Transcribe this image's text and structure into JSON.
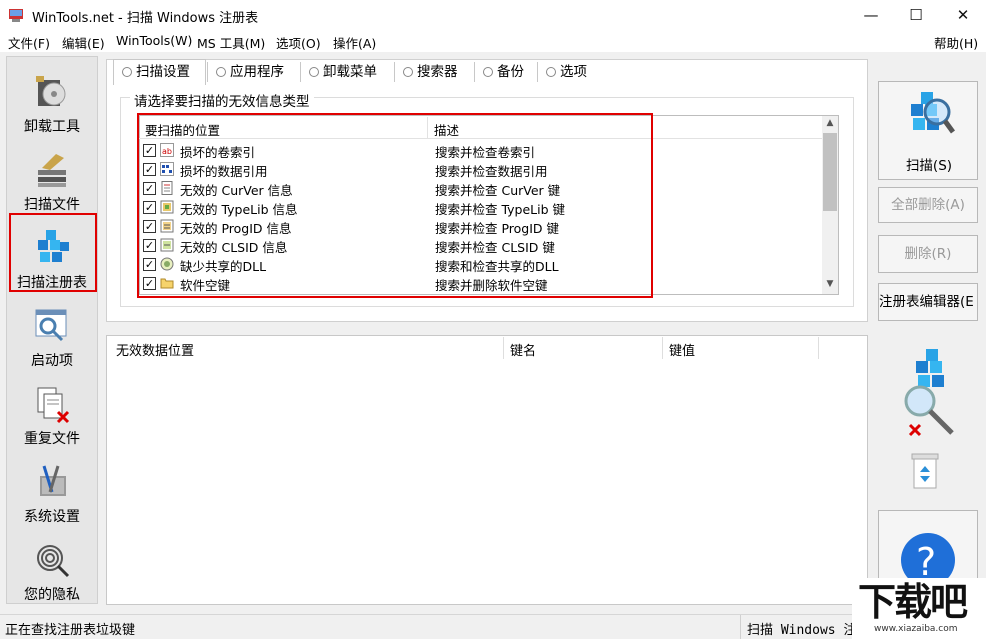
{
  "window": {
    "title": "WinTools.net - 扫描 Windows 注册表",
    "controls": {
      "minimize": "—",
      "maximize": "☐",
      "close": "✕"
    }
  },
  "menu": {
    "items": [
      "文件(F)",
      "编辑(E)",
      "WinTools(W)",
      "MS 工具(M)",
      "选项(O)",
      "操作(A)"
    ],
    "help": "帮助(H)"
  },
  "sidebar": {
    "items": [
      {
        "label": "卸载工具",
        "icon": "uninstall-icon"
      },
      {
        "label": "扫描文件",
        "icon": "scan-files-icon"
      },
      {
        "label": "扫描注册表",
        "icon": "registry-cubes-icon",
        "selected": true
      },
      {
        "label": "启动项",
        "icon": "startup-icon"
      },
      {
        "label": "重复文件",
        "icon": "duplicate-files-icon"
      },
      {
        "label": "系统设置",
        "icon": "system-tools-icon"
      },
      {
        "label": "您的隐私",
        "icon": "fingerprint-icon"
      }
    ]
  },
  "tabs": [
    "扫描设置",
    "应用程序",
    "卸载菜单",
    "搜索器",
    "备份",
    "选项"
  ],
  "scan_settings": {
    "group_title": "请选择要扫描的无效信息类型",
    "columns": [
      "要扫描的位置",
      "描述"
    ],
    "rows": [
      {
        "location": "损坏的卷索引",
        "description": "搜索并检查卷索引",
        "checked": true,
        "icon": "ab-index-icon"
      },
      {
        "location": "损坏的数据引用",
        "description": "搜索并检查数据引用",
        "checked": true,
        "icon": "binary-data-icon"
      },
      {
        "location": "无效的 CurVer 信息",
        "description": "搜索并检查 CurVer 键",
        "checked": true,
        "icon": "document-icon"
      },
      {
        "location": "无效的 TypeLib 信息",
        "description": "搜索并检查 TypeLib 键",
        "checked": true,
        "icon": "typelib-icon"
      },
      {
        "location": "无效的 ProgID 信息",
        "description": "搜索并检查 ProgID 键",
        "checked": true,
        "icon": "progid-icon"
      },
      {
        "location": "无效的 CLSID 信息",
        "description": "搜索并检查 CLSID 键",
        "checked": true,
        "icon": "clsid-icon"
      },
      {
        "location": "缺少共享的DLL",
        "description": "搜索和检查共享的DLL",
        "checked": true,
        "icon": "dll-icon"
      },
      {
        "location": "软件空键",
        "description": "搜索并删除软件空键",
        "checked": true,
        "icon": "folder-icon"
      }
    ]
  },
  "results": {
    "columns": [
      "无效数据位置",
      "键名",
      "键值"
    ]
  },
  "actions": {
    "scan": "扫描(S)",
    "delete_all": "全部删除(A)",
    "delete": "删除(R)",
    "regedit": "注册表编辑器(E"
  },
  "status": {
    "left": "正在查找注册表垃圾键",
    "right": "扫描 Windows 注"
  },
  "watermark": {
    "brand": "下载吧",
    "url": "www.xiazaiba.com"
  },
  "colors": {
    "highlight": "#e00000",
    "registry_blue": "#1e7fd0"
  }
}
